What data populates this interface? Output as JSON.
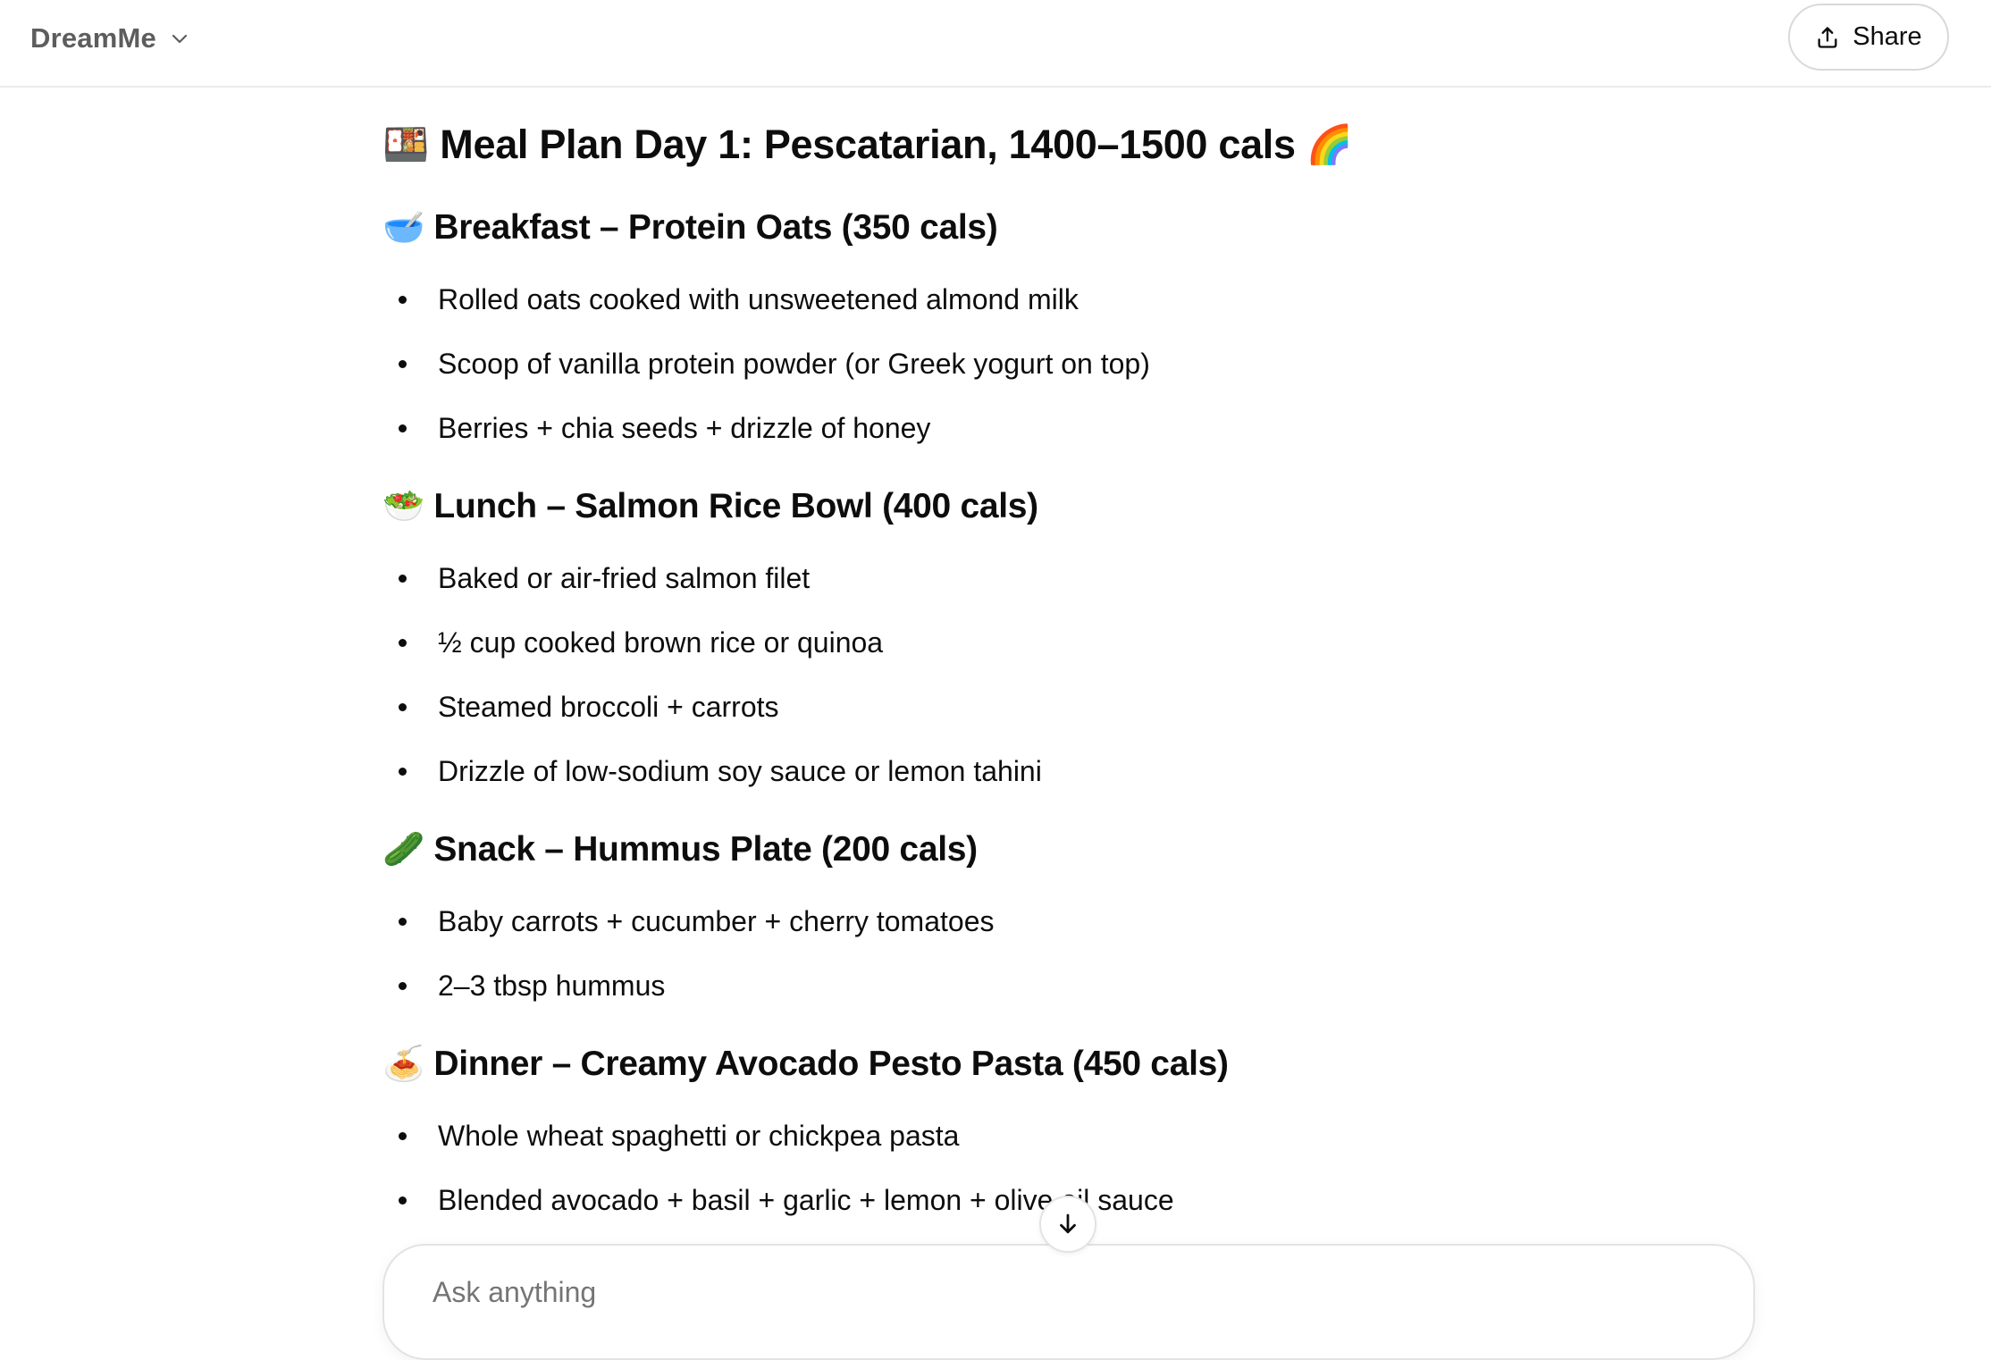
{
  "header": {
    "model_name": "DreamMe",
    "share_label": "Share"
  },
  "message": {
    "title": "Meal Plan Day 1: Pescatarian, 1400–1500 cals",
    "title_emoji_left": "🍱",
    "title_emoji_right": "🌈",
    "sections": [
      {
        "emoji": "🥣",
        "heading": "Breakfast – Protein Oats (350 cals)",
        "items": [
          "Rolled oats cooked with unsweetened almond milk",
          "Scoop of vanilla protein powder (or Greek yogurt on top)",
          "Berries + chia seeds + drizzle of honey"
        ]
      },
      {
        "emoji": "🥗",
        "heading": "Lunch – Salmon Rice Bowl (400 cals)",
        "items": [
          "Baked or air-fried salmon filet",
          "½ cup cooked brown rice or quinoa",
          "Steamed broccoli + carrots",
          "Drizzle of low-sodium soy sauce or lemon tahini"
        ]
      },
      {
        "emoji": "🥒",
        "heading": "Snack – Hummus Plate (200 cals)",
        "items": [
          "Baby carrots + cucumber + cherry tomatoes",
          "2–3 tbsp hummus"
        ]
      },
      {
        "emoji": "🍝",
        "heading": "Dinner – Creamy Avocado Pesto Pasta (450 cals)",
        "items": [
          "Whole wheat spaghetti or chickpea pasta",
          "Blended avocado + basil + garlic + lemon + olive oil sauce"
        ]
      }
    ]
  },
  "composer": {
    "placeholder": "Ask anything"
  },
  "icons": {
    "share": "share-upload-icon",
    "chevron": "chevron-down-icon",
    "scroll": "arrow-down-icon"
  }
}
